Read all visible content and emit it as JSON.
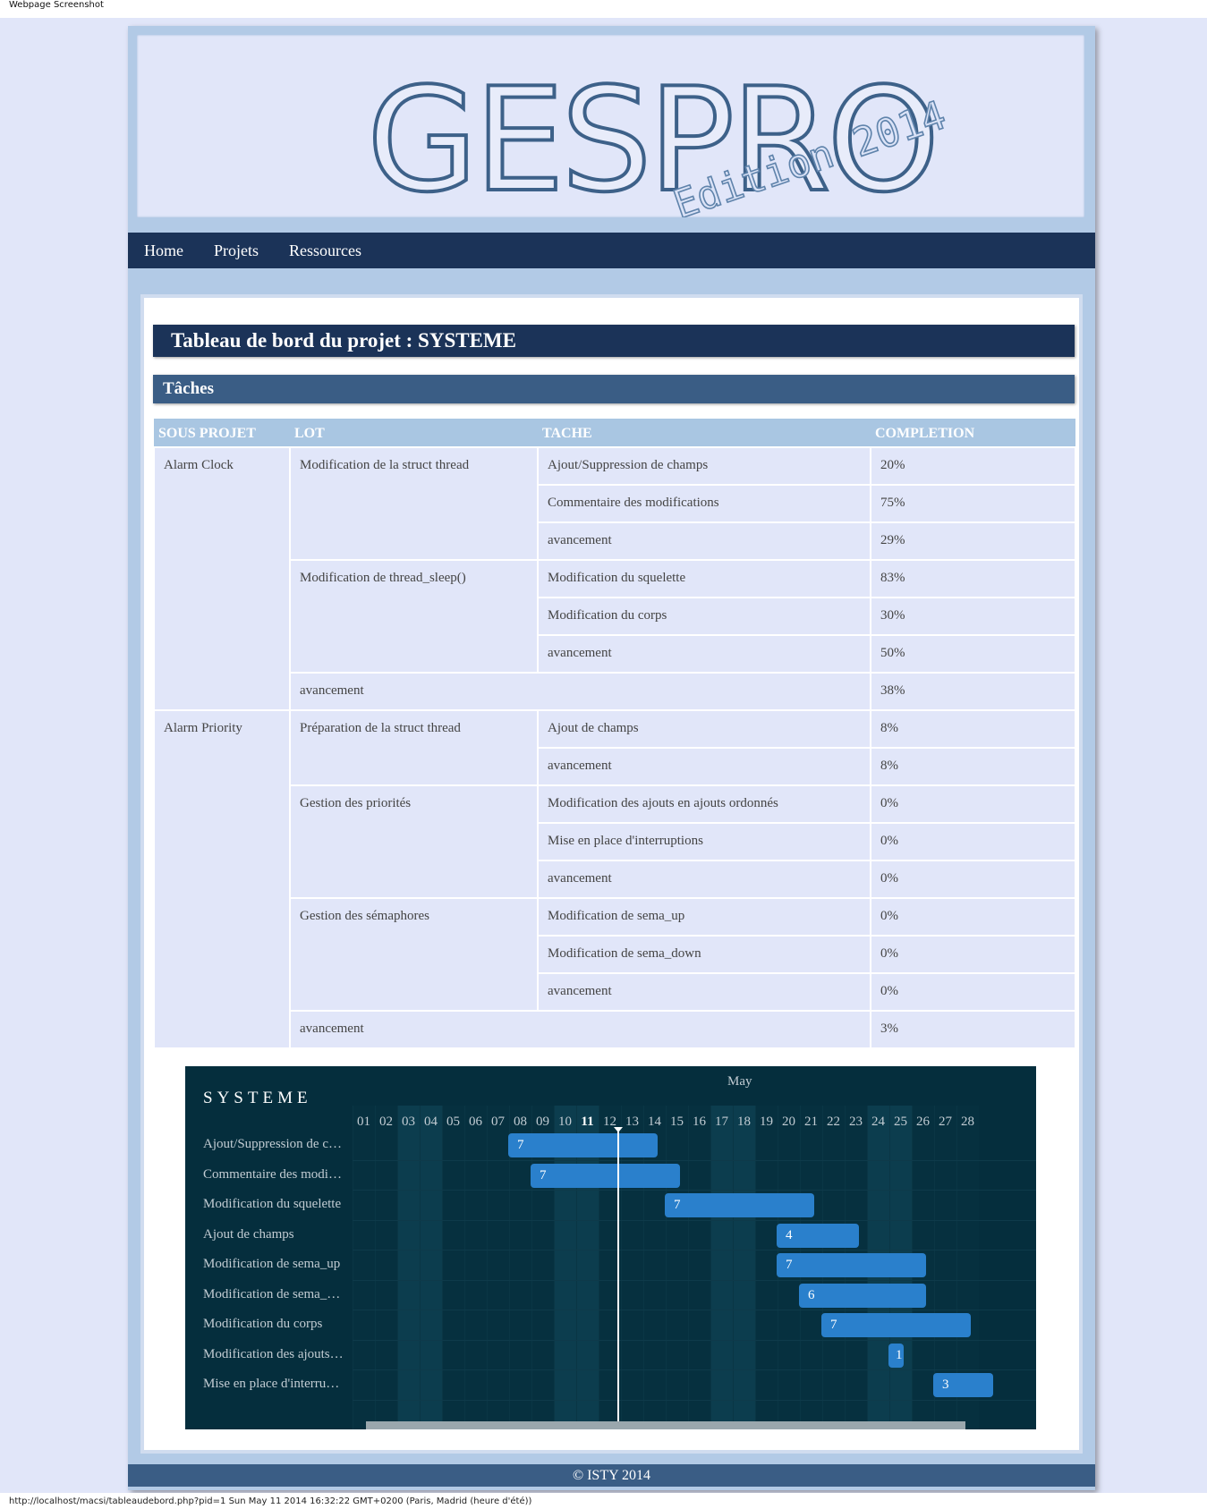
{
  "browser": {
    "caption": "Webpage Screenshot",
    "status_url": "http://localhost/macsi/tableaudebord.php?pid=1 Sun May 11 2014 16:32:22 GMT+0200 (Paris, Madrid (heure d'été))"
  },
  "header": {
    "logo_title": "GESPRO",
    "logo_edition": "Edition 2014"
  },
  "nav": {
    "items": [
      "Home",
      "Projets",
      "Ressources"
    ]
  },
  "main": {
    "title": "Tableau de bord du projet : SYSTEME",
    "section": "Tâches"
  },
  "table": {
    "headers": [
      "SOUS PROJET",
      "LOT",
      "TACHE",
      "COMPLETION"
    ],
    "subprojects": [
      "Alarm Clock",
      "Alarm Priority"
    ],
    "lots": [
      "Modification de la struct thread",
      "Modification de thread_sleep()",
      "Préparation de la struct thread",
      "Gestion des priorités",
      "Gestion des sémaphores"
    ],
    "rows": [
      [
        "Ajout/Suppression de champs",
        "20%"
      ],
      [
        "Commentaire des modifications",
        "75%"
      ],
      [
        "avancement",
        "29%"
      ],
      [
        "Modification du squelette",
        "83%"
      ],
      [
        "Modification du corps",
        "30%"
      ],
      [
        "avancement",
        "50%"
      ],
      [
        "avancement",
        "38%"
      ],
      [
        "Ajout de champs",
        "8%"
      ],
      [
        "avancement",
        "8%"
      ],
      [
        "Modification des ajouts en ajouts ordonnés",
        "0%"
      ],
      [
        "Mise en place d'interruptions",
        "0%"
      ],
      [
        "avancement",
        "0%"
      ],
      [
        "Modification de sema_up",
        "0%"
      ],
      [
        "Modification de sema_down",
        "0%"
      ],
      [
        "avancement",
        "0%"
      ],
      [
        "avancement",
        "3%"
      ]
    ]
  },
  "gantt": {
    "project": "SYSTEME",
    "month": "May",
    "today": "11",
    "days": [
      "01",
      "02",
      "03",
      "04",
      "05",
      "06",
      "07",
      "08",
      "09",
      "10",
      "11",
      "12",
      "13",
      "14",
      "15",
      "16",
      "17",
      "18",
      "19",
      "20",
      "21",
      "22",
      "23",
      "24",
      "25",
      "26",
      "27",
      "28"
    ],
    "weekend_days": [
      "03",
      "04",
      "10",
      "11",
      "17",
      "18",
      "24",
      "25"
    ],
    "tasks": [
      {
        "label": "Ajout/Suppression de c…",
        "start": 8,
        "duration": 7
      },
      {
        "label": "Commentaire des modi…",
        "start": 9,
        "duration": 7
      },
      {
        "label": "Modification du squelette",
        "start": 15,
        "duration": 7
      },
      {
        "label": "Ajout de champs",
        "start": 20,
        "duration": 4
      },
      {
        "label": "Modification de sema_up",
        "start": 20,
        "duration": 7
      },
      {
        "label": "Modification de sema_…",
        "start": 21,
        "duration": 6
      },
      {
        "label": "Modification du corps",
        "start": 22,
        "duration": 7
      },
      {
        "label": "Modification des ajouts…",
        "start": 25,
        "duration": 1
      },
      {
        "label": "Mise en place d'interru…",
        "start": 27,
        "duration": 3
      }
    ]
  },
  "footer": {
    "text": "© ISTY 2014"
  },
  "colors": {
    "nav_bg": "#1b3358",
    "section_bg": "#3a5d85",
    "table_header_bg": "#a9c6e2",
    "cell_bg": "#e1e6f9",
    "gantt_bg": "#052e3d",
    "gantt_bar": "#2a80cc"
  }
}
